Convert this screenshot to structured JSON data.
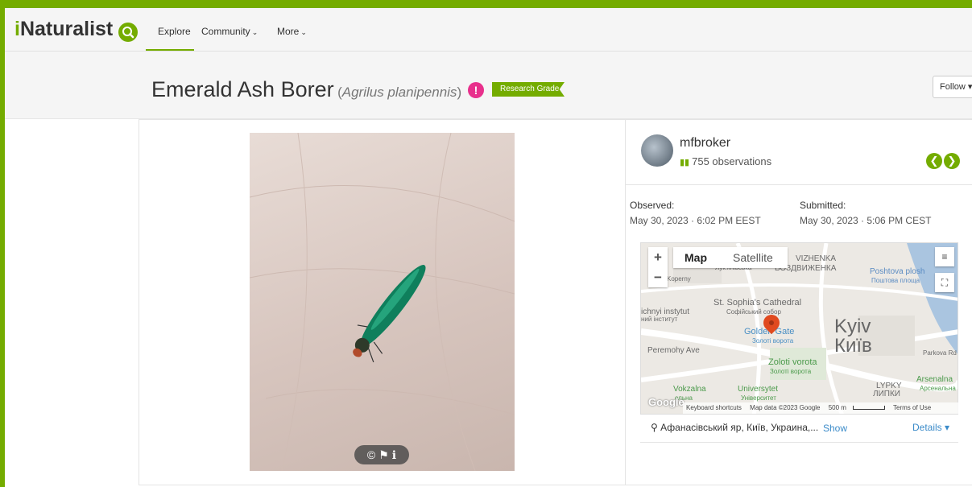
{
  "nav": {
    "logo_prefix": "i",
    "logo_suffix": "Naturalist",
    "search_icon": "search-icon",
    "explore": "Explore",
    "community": "Community",
    "more": "More",
    "caret": "⌄"
  },
  "title": {
    "common_name": "Emerald Ash Borer",
    "sci_open": "(",
    "sci_name": "Agrilus planipennis",
    "sci_close": ")",
    "alert": "!",
    "grade": "Research Grade",
    "follow": "Follow ▾"
  },
  "photo": {
    "controls": [
      "©",
      "⚑",
      "ℹ"
    ]
  },
  "user": {
    "name": "mfbroker",
    "observations": "755 observations",
    "prev": "❮",
    "next": "❯"
  },
  "dates": {
    "observed_label": "Observed:",
    "observed_value": "May 30, 2023 · 6:02 PM EEST",
    "submitted_label": "Submitted:",
    "submitted_value": "May 30, 2023 · 5:06 PM CEST"
  },
  "map": {
    "zoom_in": "+",
    "zoom_out": "−",
    "map_tab": "Map",
    "satellite_tab": "Satellite",
    "labels": {
      "vozdvyzhenka": "VIZHENKA",
      "vozdvyzhenka_ua": "ВОЗДВИЖЕНКА",
      "poshtova": "Poshtova plosh",
      "poshtova_ua": "Поштова площа",
      "sophia": "St. Sophia's Cathedral",
      "sophia_ua": "Софійський собор",
      "instytut": "ichnyi instytut",
      "instytut_ua": "ний інститут",
      "golden_gate": "Golden Gate",
      "golden_gate_ua": "Золоті ворота",
      "kyiv": "Kyiv",
      "kyiv_ua": "Київ",
      "peremohy": "Peremohy Ave",
      "zoloti": "Zoloti vorota",
      "zoloti_ua": "Золоті ворота",
      "lypky": "LYPKY",
      "lypky_ua": "ЛИПКИ",
      "arsenalna": "Arsenalna",
      "arsenalna_ua": "Арсенальна",
      "vokzalna": "Vokzalna",
      "vokzalna_ua": "ельна",
      "universytet": "Universytet",
      "universytet_ua": "Університет",
      "kopernyka": "Koperny",
      "lukianivska": "Лук'янівська",
      "parkova": "Parkova Rd"
    },
    "google": "Google",
    "footer": {
      "shortcuts": "Keyboard shortcuts",
      "data": "Map data ©2023 Google",
      "scale": "500 m",
      "terms": "Terms of Use"
    }
  },
  "place": {
    "pin_icon": "📍",
    "name": "Афанасівський яр, Київ, Украина,...",
    "show": "Show",
    "details": "Details ▾"
  }
}
